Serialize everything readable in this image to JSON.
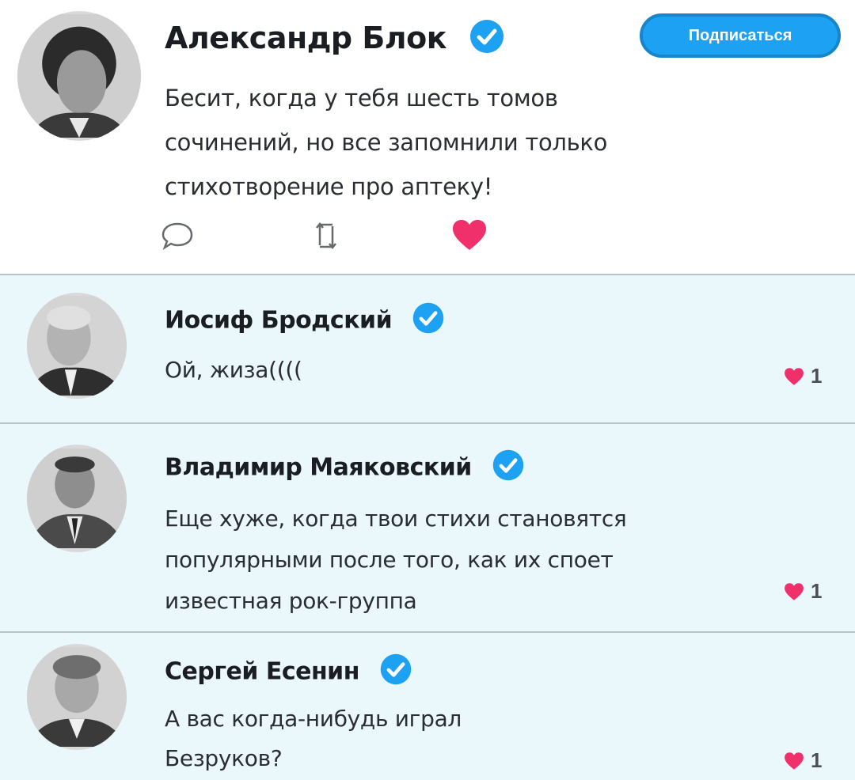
{
  "post": {
    "author": "Александр Блок",
    "subscribe_label": "Подписаться",
    "text_lines": [
      "Бесит, когда у тебя шесть томов",
      "сочинений, но все запомнили только",
      "стихотворение про аптеку!"
    ],
    "actions": [
      "comment-icon",
      "retweet-icon",
      "like-icon"
    ]
  },
  "replies": [
    {
      "author": "Иосиф Бродский",
      "text_lines": [
        "Ой, жиза(((("
      ],
      "likes": "1"
    },
    {
      "author": "Владимир Маяковский",
      "text_lines": [
        "Еще хуже, когда твои стихи становятся",
        "популярными после того, как их споет",
        "известная рок-группа"
      ],
      "likes": "1"
    },
    {
      "author": "Сергей Есенин",
      "text_lines": [
        "А вас когда-нибудь играл",
        "Безруков?"
      ],
      "likes": "1"
    }
  ],
  "colors": {
    "accent": "#1da1f2",
    "like": "#f0306b",
    "reply_bg": "#eaf7fb"
  }
}
